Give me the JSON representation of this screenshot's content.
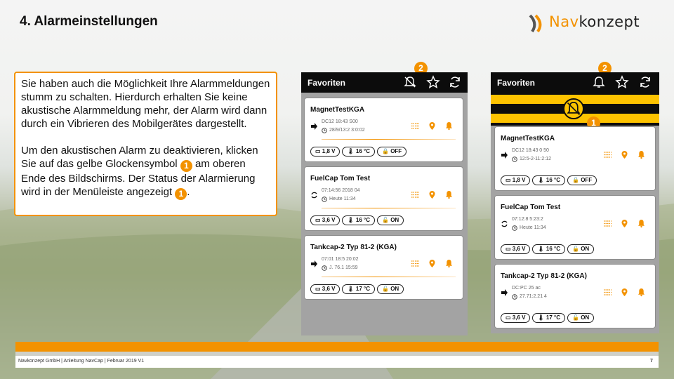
{
  "slide": {
    "title": "4. Alarmeinstellungen",
    "logo_prefix": "Nav",
    "logo_suffix": "konzept"
  },
  "info": {
    "p1": "Sie haben auch die Möglichkeit Ihre Alarmmeldungen stumm zu schalten. Hierdurch erhalten Sie keine akustische Alarmmeldung mehr, der Alarm wird dann durch ein Vibrieren des Mobilgerätes dargestellt.",
    "p2_a": "Um den akustischen Alarm zu deaktivieren, klicken Sie auf das gelbe Glockensymbol ",
    "p2_b": " am oberen Ende des Bildschirms. Der Status der Alarmierung wird in der Menüleiste angezeigt ",
    "p2_c": ".",
    "badge": "1"
  },
  "badges": {
    "one": "1",
    "two": "2"
  },
  "phone_a": {
    "header": "Favoriten",
    "cards": [
      {
        "name": "MagnetTestKGA",
        "line1": "DC12 18:43 S00",
        "line2": "28/9/13:2 3:0:02",
        "battery": "1,8 V",
        "temp": "16 °C",
        "lock": "OFF",
        "lock_state": "locked"
      },
      {
        "name": "FuelCap Tom Test",
        "line1": "07:14:56 2018 04",
        "line2": "Heute 11:34",
        "battery": "3,6 V",
        "temp": "16 °C",
        "lock": "ON",
        "lock_state": "open"
      },
      {
        "name": "Tankcap-2 Typ 81-2 (KGA)",
        "line1": "07:01 18:5 20:02",
        "line2": "J. 76.1 15:59",
        "battery": "3,6 V",
        "temp": "17 °C",
        "lock": "ON",
        "lock_state": "open"
      }
    ]
  },
  "phone_b": {
    "header": "Favoriten",
    "cards": [
      {
        "name": "MagnetTestKGA",
        "line1": "DC12 18:43 0 50",
        "line2": "12:5-2-11:2:12",
        "battery": "1,8 V",
        "temp": "16 °C",
        "lock": "OFF",
        "lock_state": "locked"
      },
      {
        "name": "FuelCap Tom Test",
        "line1": "07:12:8 5:23:2",
        "line2": "Heute 11:34",
        "battery": "3,6 V",
        "temp": "16 °C",
        "lock": "ON",
        "lock_state": "open"
      },
      {
        "name": "Tankcap-2 Typ 81-2 (KGA)",
        "line1": "DC:PC 25 ac",
        "line2": "27.71:2.21 4",
        "battery": "3,6 V",
        "temp": "17 °C",
        "lock": "ON",
        "lock_state": "open"
      }
    ]
  },
  "footer": {
    "text": "Navkonzept GmbH | Anleitung NavCap | Februar 2019 V1",
    "page": "7"
  },
  "colors": {
    "accent": "#f39200",
    "yellow": "#fdc300",
    "header": "#0c0c0c"
  }
}
